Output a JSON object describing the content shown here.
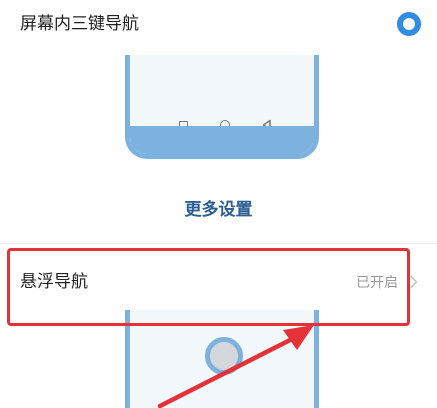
{
  "options": {
    "three_key_nav_label": "屏幕内三键导航",
    "three_key_nav_selected": true
  },
  "more_settings": {
    "label": "更多设置"
  },
  "floating_nav": {
    "label": "悬浮导航",
    "status": "已开启"
  },
  "colors": {
    "accent": "#2f8de4",
    "mockup": "#7cb2dd",
    "link": "#2c5f91",
    "highlight": "#e53238"
  },
  "icons": {
    "nav_square": "square-icon",
    "nav_circle": "circle-icon",
    "nav_back": "back-triangle-icon",
    "chevron": "chevron-right-icon"
  }
}
